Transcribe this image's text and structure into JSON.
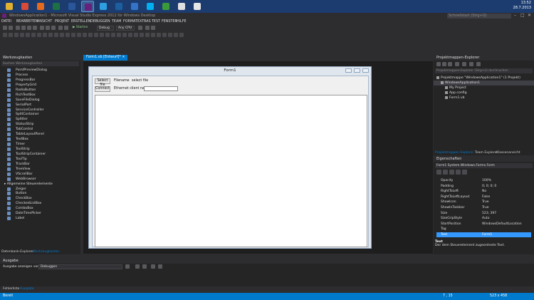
{
  "taskbar": {
    "apps": [
      {
        "name": "windows-explorer",
        "color": "#e0b030"
      },
      {
        "name": "chrome",
        "color": "#d94a38"
      },
      {
        "name": "firefox",
        "color": "#e66a1e"
      },
      {
        "name": "excel",
        "color": "#1d7044"
      },
      {
        "name": "word",
        "color": "#2b579a"
      },
      {
        "name": "visual-studio",
        "color": "#68217a"
      },
      {
        "name": "photoshop",
        "color": "#2d9ee0"
      },
      {
        "name": "photoshop-2",
        "color": "#1c5fa0"
      },
      {
        "name": "app-blue",
        "color": "#3573c8"
      },
      {
        "name": "skype",
        "color": "#00aff0"
      },
      {
        "name": "app-green",
        "color": "#3a9a3a"
      },
      {
        "name": "app-circle",
        "color": "#e0e0e0"
      },
      {
        "name": "app-white",
        "color": "#e6e6e6"
      }
    ],
    "time": "13:52",
    "date": "28.7.2013"
  },
  "window": {
    "title": "WindowsApplication1 - Microsoft Visual Studio Express 2012 für Windows Desktop",
    "quick_launch": "Schnellstart (Strg+Q)"
  },
  "menu": [
    "DATEI",
    "BEARBEITEN",
    "ANSICHT",
    "PROJEKT",
    "ERSTELLEN",
    "DEBUGGEN",
    "TEAM",
    "FORMAT",
    "EXTRAS",
    "TEST",
    "FENSTER",
    "HILFE"
  ],
  "toolbar": {
    "start_label": "▶ Starten",
    "config": "Debug",
    "platform": "Any CPU"
  },
  "toolbox": {
    "title": "Werkzeugkasten",
    "search_placeholder": "Suchen Werkzeugkasten",
    "items": [
      {
        "label": "PointPreviewDialog",
        "cat": false
      },
      {
        "label": "Process",
        "cat": false
      },
      {
        "label": "ProgressBar",
        "cat": false
      },
      {
        "label": "PropertyGrid",
        "cat": false
      },
      {
        "label": "RadioButton",
        "cat": false
      },
      {
        "label": "RichTextBox",
        "cat": false
      },
      {
        "label": "SaveFileDialog",
        "cat": false
      },
      {
        "label": "SerialPort",
        "cat": false
      },
      {
        "label": "ServiceController",
        "cat": false
      },
      {
        "label": "SplitContainer",
        "cat": false
      },
      {
        "label": "Splitter",
        "cat": false
      },
      {
        "label": "StatusStrip",
        "cat": false
      },
      {
        "label": "TabControl",
        "cat": false
      },
      {
        "label": "TableLayoutPanel",
        "cat": false
      },
      {
        "label": "TextBox",
        "cat": false
      },
      {
        "label": "Timer",
        "cat": false
      },
      {
        "label": "ToolStrip",
        "cat": false
      },
      {
        "label": "ToolStripContainer",
        "cat": false
      },
      {
        "label": "ToolTip",
        "cat": false
      },
      {
        "label": "TrackBar",
        "cat": false
      },
      {
        "label": "TreeView",
        "cat": false
      },
      {
        "label": "VScrollBar",
        "cat": false
      },
      {
        "label": "WebBrowser",
        "cat": false
      },
      {
        "label": "▸ Allgemeine Steuerelemente",
        "cat": true
      },
      {
        "label": "Zeiger",
        "cat": false
      },
      {
        "label": "Button",
        "cat": false
      },
      {
        "label": "CheckBox",
        "cat": false
      },
      {
        "label": "CheckedListBox",
        "cat": false
      },
      {
        "label": "ComboBox",
        "cat": false
      },
      {
        "label": "DateTimePicker",
        "cat": false
      },
      {
        "label": "Label",
        "cat": false
      }
    ],
    "tab_server": "Datenbank-Explorer",
    "tab_toolbox": "Werkzeugkasten"
  },
  "document_tab": "Form1.vb [Entwurf]*",
  "form1": {
    "title": "Form1",
    "select_button": "Select file",
    "filename_label": "Filename",
    "filename_value": "select file",
    "connect_button": "Connect",
    "client_label": "Ethernet client name"
  },
  "solution_explorer": {
    "title": "Projektmappen-Explorer",
    "search_placeholder": "Projektmappen-Explorer (Strg+ü) durchsuchen",
    "items": [
      {
        "label": "Projektmappe \"WindowsApplication1\" (1 Projekt)",
        "indent": 0,
        "sel": false
      },
      {
        "label": "WindowsApplication1",
        "indent": 1,
        "sel": true
      },
      {
        "label": "My Project",
        "indent": 2,
        "sel": false
      },
      {
        "label": "App.config",
        "indent": 2,
        "sel": false
      },
      {
        "label": "Form1.vb",
        "indent": 2,
        "sel": false
      }
    ],
    "tabs": [
      "Projektmappen-Explorer",
      "Team Explorer",
      "Klassenansicht"
    ]
  },
  "properties": {
    "title": "Eigenschaften",
    "selector": "Form1 System.Windows.Forms.Form",
    "rows": [
      {
        "k": "Opacity",
        "v": "100%",
        "sel": false
      },
      {
        "k": "Padding",
        "v": "0; 0; 0; 0",
        "sel": false
      },
      {
        "k": "RightToLeft",
        "v": "No",
        "sel": false
      },
      {
        "k": "RightToLeftLayout",
        "v": "False",
        "sel": false
      },
      {
        "k": "ShowIcon",
        "v": "True",
        "sel": false
      },
      {
        "k": "ShowInTaskbar",
        "v": "True",
        "sel": false
      },
      {
        "k": "Size",
        "v": "523; 397",
        "sel": false
      },
      {
        "k": "SizeGripStyle",
        "v": "Auto",
        "sel": false
      },
      {
        "k": "StartPosition",
        "v": "WindowsDefaultLocation",
        "sel": false
      },
      {
        "k": "Tag",
        "v": "",
        "sel": false
      },
      {
        "k": "Text",
        "v": "Form1",
        "sel": true
      }
    ],
    "desc_title": "Text",
    "desc_text": "Der dem Steuerelement zugeordnete Text."
  },
  "output": {
    "title": "Ausgabe",
    "show_from_label": "Ausgabe anzeigen von:",
    "show_from_value": "Debuggen"
  },
  "bottom_tabs": [
    "Fehlerliste",
    "Ausgabe"
  ],
  "status": {
    "left": "Bereit",
    "pos": "7 , 15",
    "size": "523 x 458"
  },
  "colors": {
    "accent": "#007acc",
    "taskbar": "#1c3c70"
  }
}
